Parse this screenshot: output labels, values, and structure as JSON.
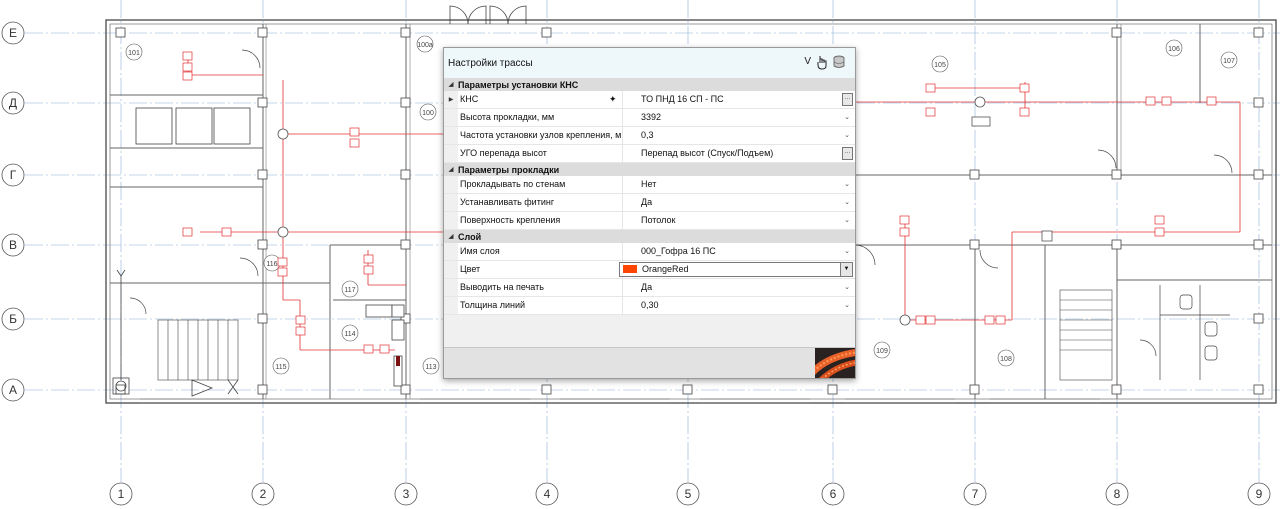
{
  "axes": {
    "rows": [
      "Е",
      "Д",
      "Г",
      "В",
      "Б",
      "А"
    ],
    "columns": [
      "1",
      "2",
      "3",
      "4",
      "5",
      "6",
      "7",
      "8",
      "9"
    ]
  },
  "rooms": [
    "101",
    "100а",
    "100",
    "105",
    "106",
    "107",
    "116",
    "117",
    "114",
    "115",
    "113",
    "109",
    "108"
  ],
  "dialog": {
    "title": "Настройки трассы",
    "v_label": "V",
    "hand_icon": "hand-pointer-icon",
    "db_icon": "database-icon",
    "sections": [
      {
        "title": "Параметры установки КНС",
        "rows": [
          {
            "name": "КНС",
            "value": "ТО ПНД 16 СП - ПС",
            "expandable": true,
            "control": "dots"
          },
          {
            "name": "Высота прокладки, мм",
            "value": "3392",
            "control": "chevron"
          },
          {
            "name": "Частота установки узлов крепления, м",
            "value": "0,3",
            "control": "chevron"
          },
          {
            "name": "УГО перепада высот",
            "value": "Перепад высот (Спуск/Подъем)",
            "control": "dots"
          }
        ]
      },
      {
        "title": "Параметры прокладки",
        "rows": [
          {
            "name": "Прокладывать по стенам",
            "value": "Нет",
            "control": "chevron"
          },
          {
            "name": "Устанавливать фитинг",
            "value": "Да",
            "control": "chevron"
          },
          {
            "name": "Поверхность крепления",
            "value": "Потолок",
            "control": "chevron"
          }
        ]
      },
      {
        "title": "Слой",
        "rows": [
          {
            "name": "Имя слоя",
            "value": "000_Гофра 16 ПС",
            "control": "chevron"
          },
          {
            "name": "Цвет",
            "value": "OrangeRed",
            "control": "color",
            "color": "#ff4500"
          },
          {
            "name": "Выводить на печать",
            "value": "Да",
            "control": "chevron"
          },
          {
            "name": "Толщина линий",
            "value": "0,30",
            "control": "chevron"
          }
        ]
      }
    ]
  },
  "colors": {
    "route": "#e03030",
    "axis_line": "#8ab0d8",
    "wall": "#555555",
    "titlebar": "#eef7fa"
  }
}
